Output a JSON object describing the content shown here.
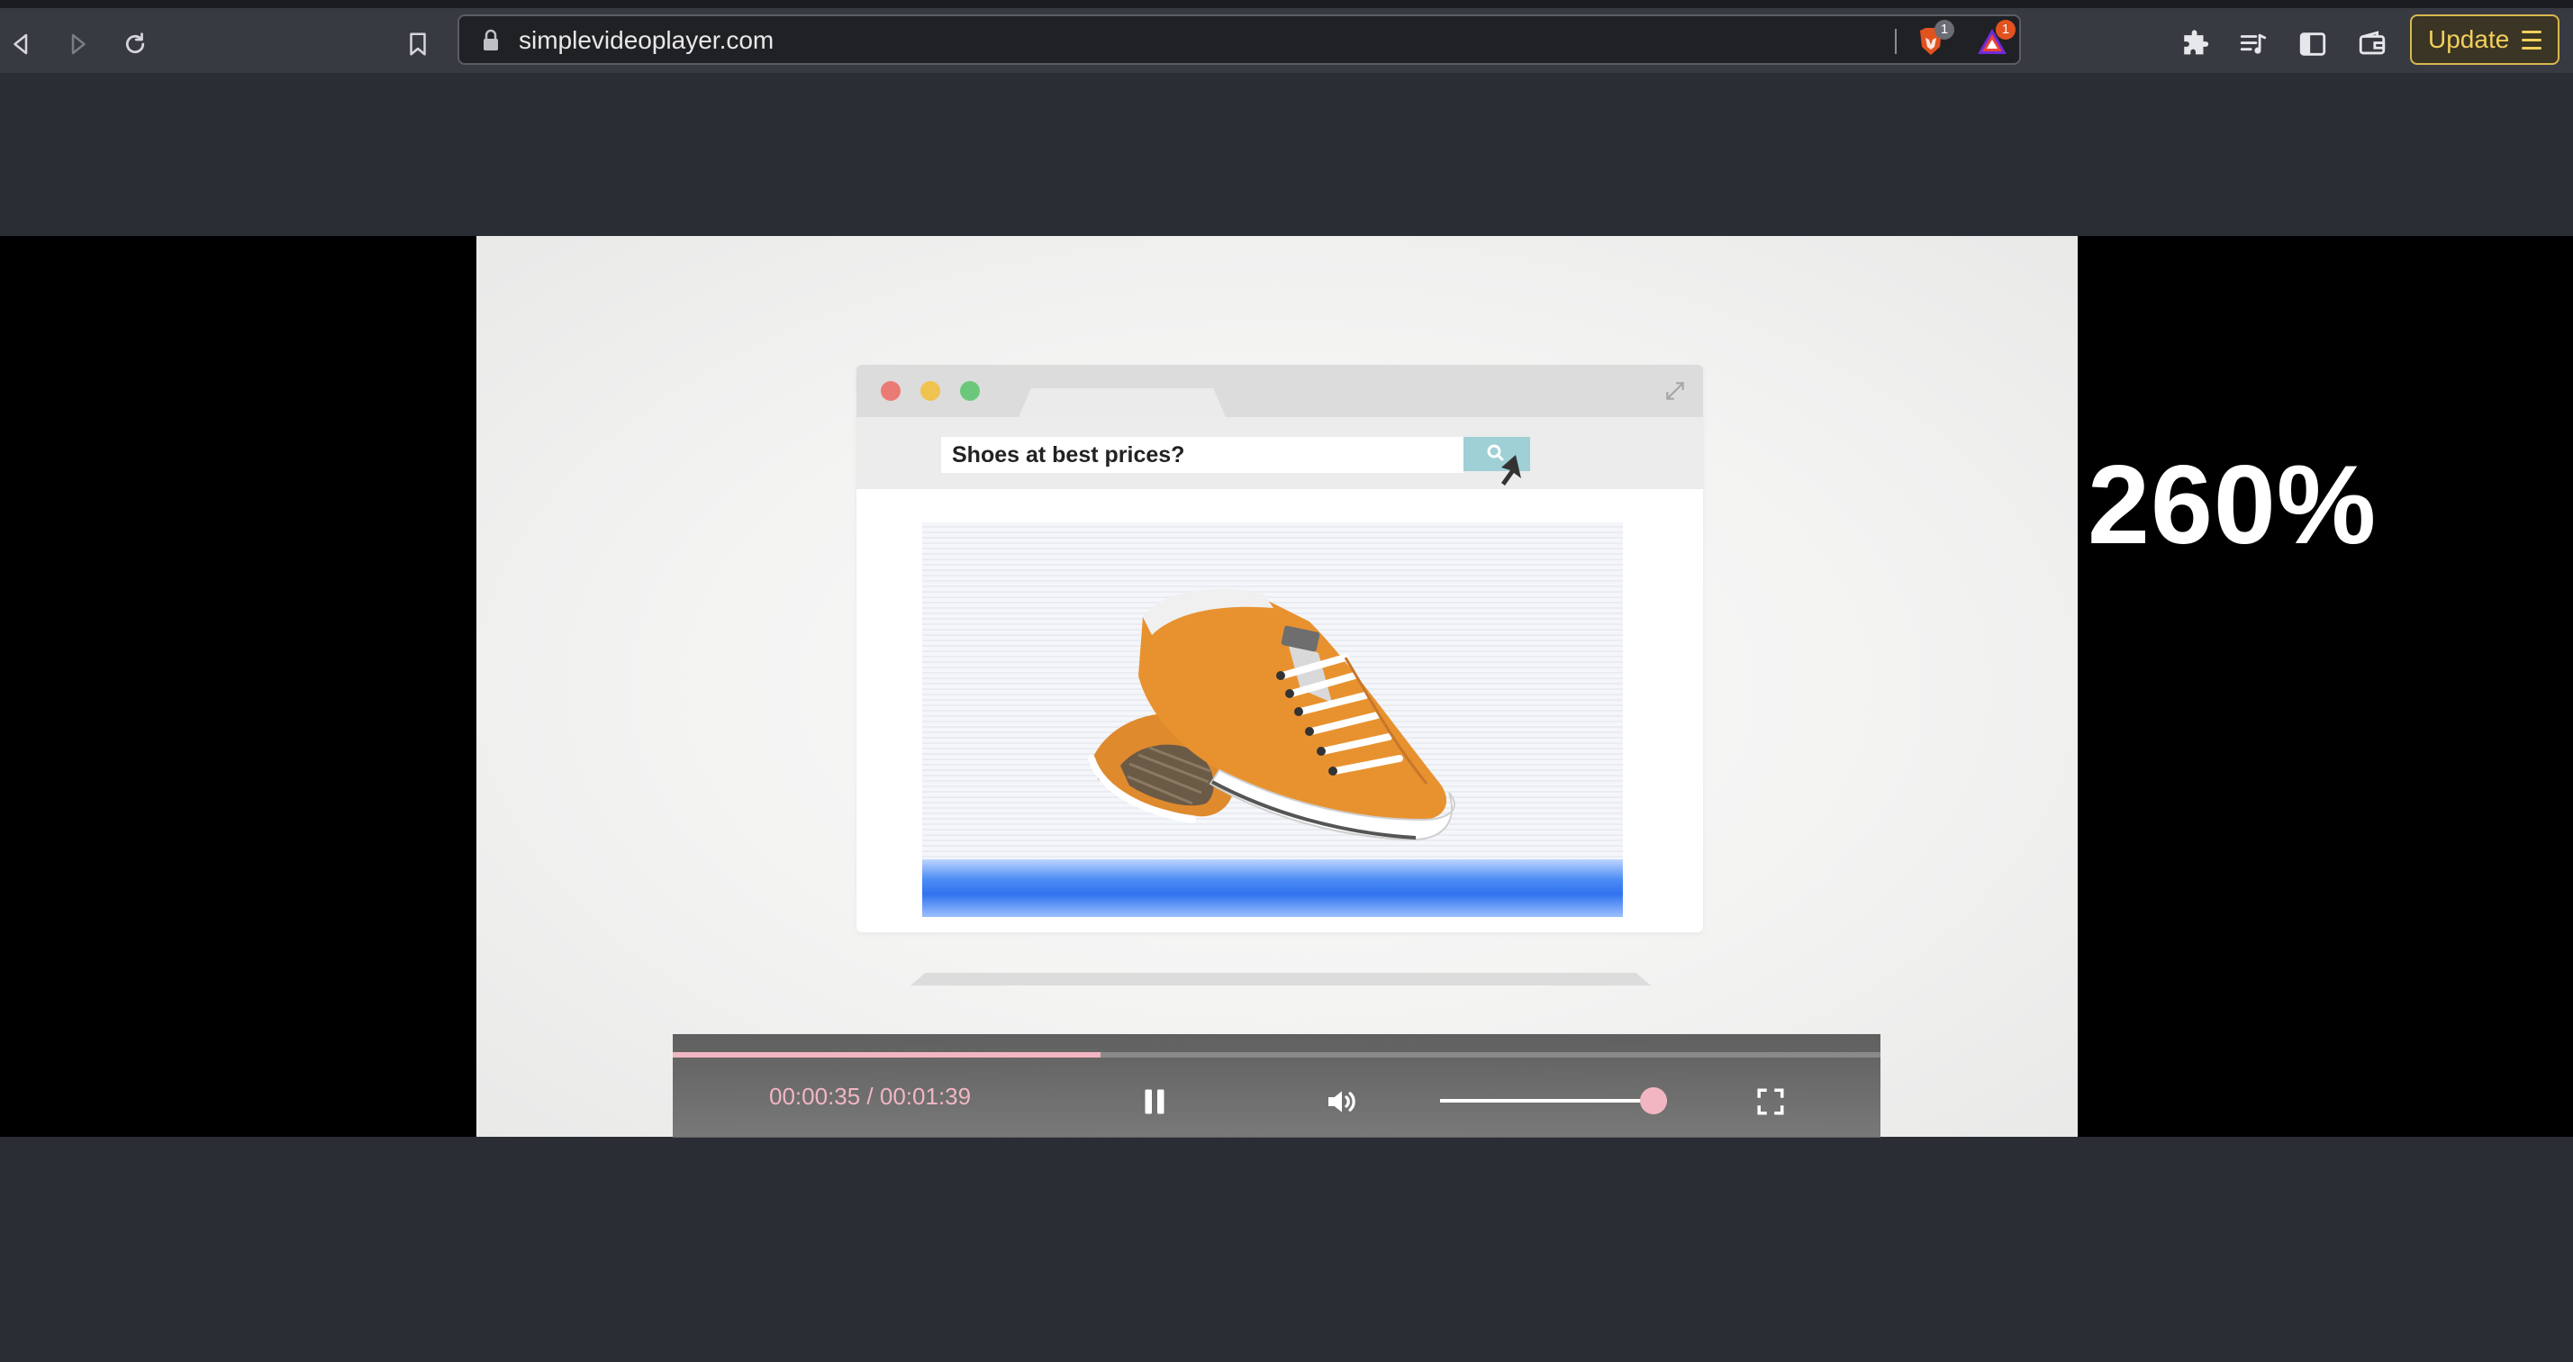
{
  "browser": {
    "url": "simplevideoplayer.com",
    "update_label": "Update",
    "extensions": [
      {
        "name": "brave-shields",
        "badge": "1"
      },
      {
        "name": "brave-rewards",
        "badge": "1"
      }
    ]
  },
  "video": {
    "overlay_text": "260%",
    "mock_search_text": "Shoes at best prices?"
  },
  "player": {
    "time_display": "00:00:35 / 00:01:39",
    "current_time": "00:00:35",
    "duration": "00:01:39",
    "progress_fraction": 0.354,
    "volume_fraction": 0.94,
    "state": "playing"
  },
  "colors": {
    "accent": "#f2b6c2",
    "update_button": "#f2cf5c",
    "page_background": "#2b2d35",
    "toolbar": "#383a42"
  },
  "icons": [
    "back-icon",
    "forward-icon",
    "reload-icon",
    "bookmark-icon",
    "lock-icon",
    "puzzle-icon",
    "playlist-icon",
    "sidebar-icon",
    "wallet-icon",
    "menu-icon",
    "pause-icon",
    "volume-icon",
    "fullscreen-icon"
  ]
}
